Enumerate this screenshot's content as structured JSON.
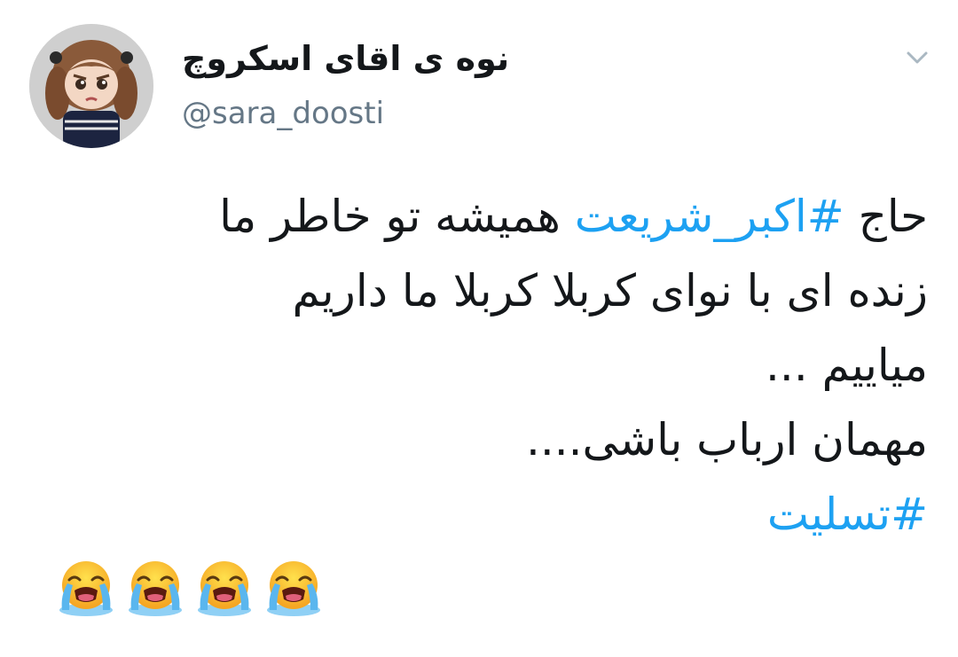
{
  "user": {
    "display_name": "نوه ی اقای اسکروچ",
    "handle": "@sara_doosti"
  },
  "tweet": {
    "line1": {
      "pre": "حاج ",
      "hashtag": "#اکبر_شریعت",
      "post": " همیشه تو خاطر ما"
    },
    "line2": "زنده ای با نوای کربلا کربلا ما داریم",
    "line3": "میاییم ...",
    "line4": "مهمان ارباب باشی....",
    "hashtag2": "#تسلیت",
    "emojis": [
      "loudly-crying-face",
      "loudly-crying-face",
      "loudly-crying-face",
      "loudly-crying-face"
    ]
  },
  "colors": {
    "hashtag": "#1da1f2",
    "text": "#14171a",
    "handle": "#657786",
    "chevron": "#aab8c2"
  },
  "icons": {
    "menu": "chevron-down-icon",
    "avatar": "avatar"
  }
}
